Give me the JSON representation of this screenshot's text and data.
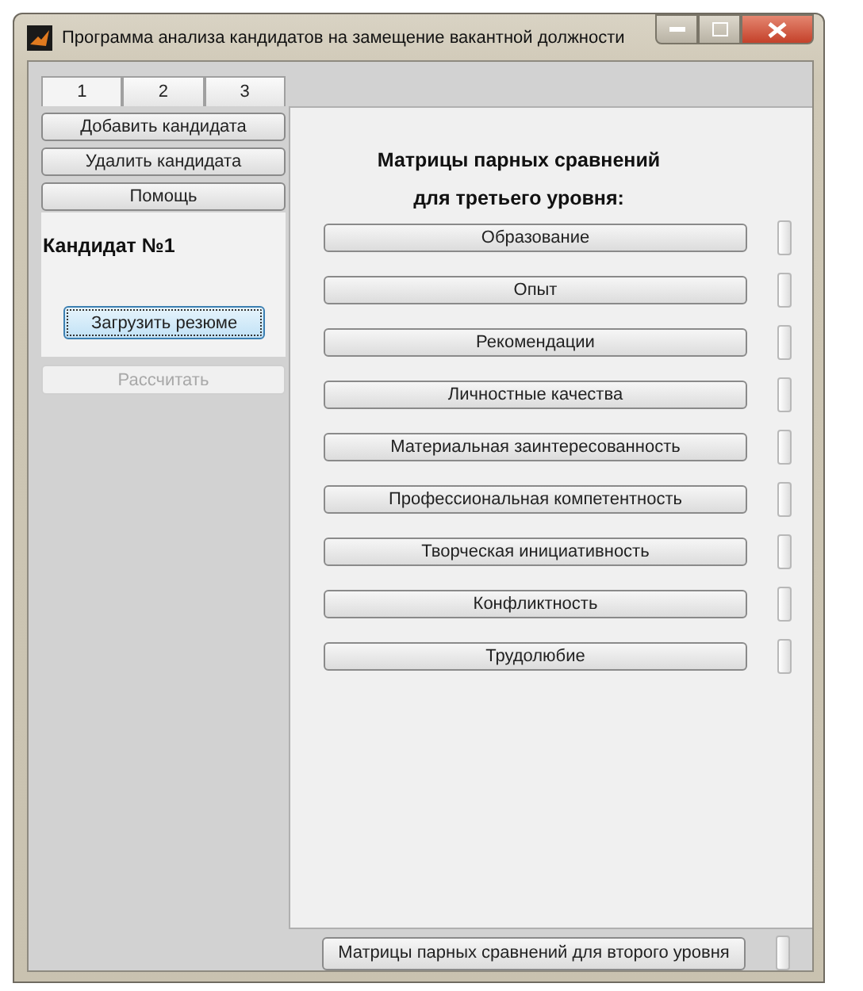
{
  "window": {
    "title": "Программа анализа кандидатов на замещение вакантной должности"
  },
  "tabs": [
    {
      "label": "1",
      "selected": true
    },
    {
      "label": "2",
      "selected": false
    },
    {
      "label": "3",
      "selected": false
    }
  ],
  "left_buttons": [
    {
      "label": "Добавить кандидата"
    },
    {
      "label": "Удалить кандидата"
    },
    {
      "label": "Помощь"
    }
  ],
  "candidate": {
    "title": "Кандидат №1",
    "load_button": {
      "label": "Загрузить резюме",
      "focused": true
    },
    "calc_button": {
      "label": "Рассчитать",
      "disabled": true
    }
  },
  "matrices": {
    "title_lines": [
      "Матрицы парных сравнений",
      "для третьего уровня:"
    ],
    "items": [
      {
        "label": "Образование",
        "filled": false
      },
      {
        "label": "Опыт",
        "filled": false
      },
      {
        "label": "Рекомендации",
        "filled": false
      },
      {
        "label": "Личностные качества",
        "filled": false
      },
      {
        "label": "Материальная заинтересованность",
        "filled": false
      },
      {
        "label": "Профессиональная компетентность",
        "filled": false
      },
      {
        "label": "Творческая инициативность",
        "filled": false
      },
      {
        "label": "Конфликтность",
        "filled": false
      },
      {
        "label": "Трудолюбие",
        "filled": false
      }
    ]
  },
  "second_level": {
    "label": "Матрицы парных сравнений для второго уровня",
    "filled": false
  }
}
